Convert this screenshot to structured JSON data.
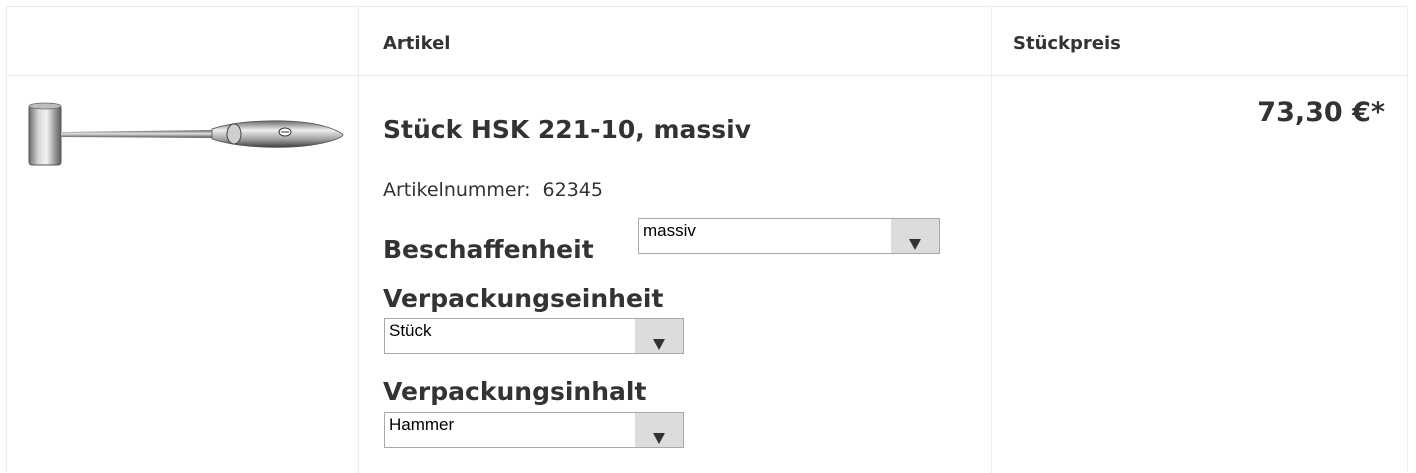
{
  "table": {
    "headers": {
      "image": "",
      "article": "Artikel",
      "unit_price": "Stückpreis"
    }
  },
  "product": {
    "image_name": "hammer-product-image",
    "title": "Stück HSK 221-10, massiv",
    "article_number_label": "Artikelnummer:",
    "article_number": "62345",
    "price": "73,30 €*",
    "options": [
      {
        "label": "Beschaffenheit",
        "selected": "massiv"
      },
      {
        "label": "Verpackungseinheit",
        "selected": "Stück"
      },
      {
        "label": "Verpackungsinhalt",
        "selected": "Hammer"
      }
    ]
  },
  "colors": {
    "text": "#333333",
    "border": "#ececec",
    "select_arrow_bg": "#dcdcdc"
  }
}
